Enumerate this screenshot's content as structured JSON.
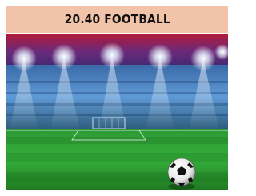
{
  "header": {
    "title": "20.40 FOOTBALL"
  },
  "photo": {
    "subject": "stadium-with-football",
    "colors": {
      "header_bg": "#f1c3a8",
      "sky_top": "#b01a3c",
      "sky_bottom": "#1a2a6e",
      "grass_light": "#39b23a",
      "grass_dark": "#1f7a22",
      "floodlight": "#ffffff"
    }
  }
}
